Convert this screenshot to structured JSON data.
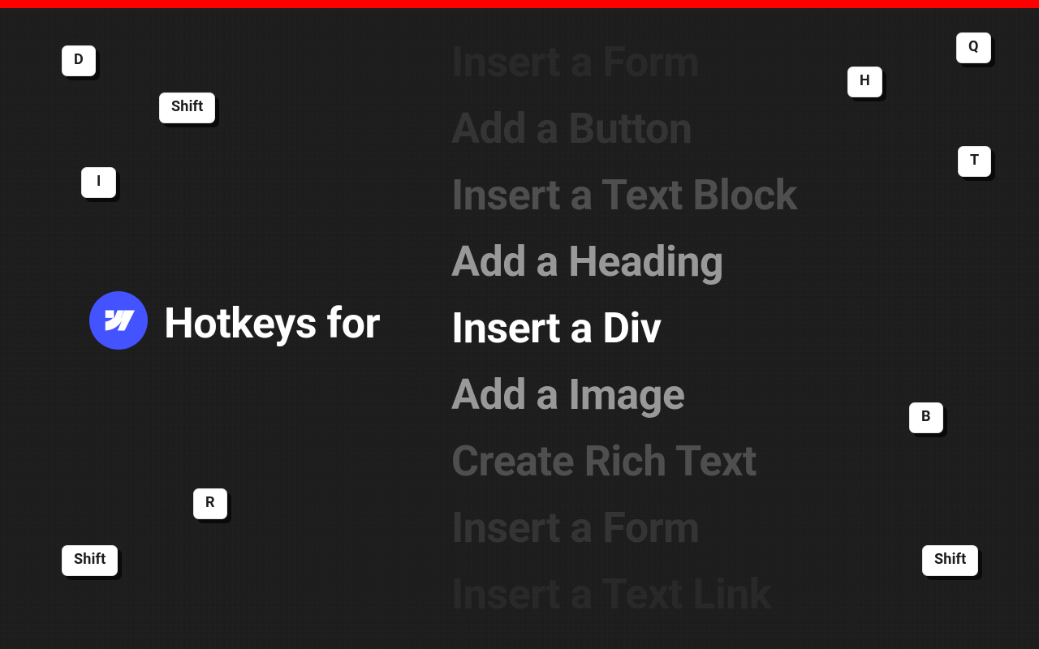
{
  "topbar_color": "#ff0000",
  "headline": "Hotkeys for",
  "logo": "webflow-logo",
  "ticker": {
    "items": [
      {
        "text": "Insert a Form",
        "emph": "op-02"
      },
      {
        "text": "Add a Button",
        "emph": "op-03"
      },
      {
        "text": "Insert a Text Block",
        "emph": "op-05"
      },
      {
        "text": "Add a Heading",
        "emph": "op-07"
      },
      {
        "text": "Insert a Div",
        "emph": "op-1"
      },
      {
        "text": "Add a Image",
        "emph": "op-07"
      },
      {
        "text": "Create Rich Text",
        "emph": "op-05"
      },
      {
        "text": "Insert a Form",
        "emph": "op-03"
      },
      {
        "text": "Insert a Text Link",
        "emph": "op-02"
      }
    ]
  },
  "keys": {
    "d": "D",
    "shift1": "Shift",
    "i": "I",
    "shift2": "Shift",
    "r": "R",
    "q": "Q",
    "h": "H",
    "t": "T",
    "b": "B",
    "shift3": "Shift"
  }
}
